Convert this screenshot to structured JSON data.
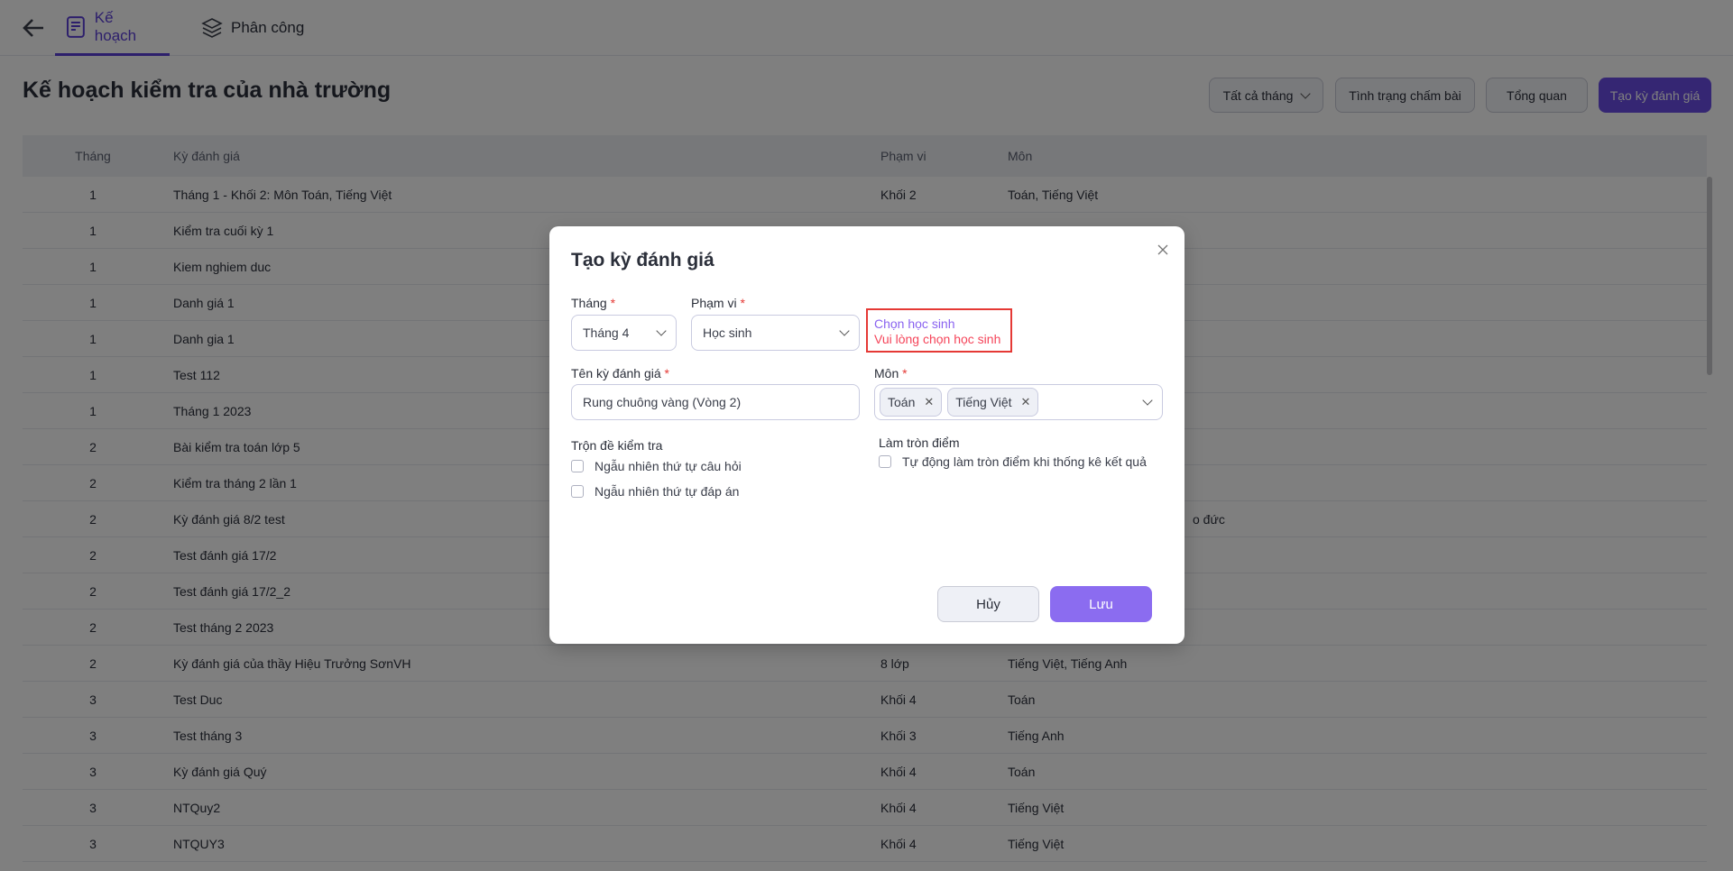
{
  "nav": {
    "back_icon": "arrow-left-icon",
    "tabs": [
      {
        "label": "Kế hoạch",
        "icon": "plan-document-icon",
        "active": true
      },
      {
        "label": "Phân công",
        "icon": "layers-icon",
        "active": false
      }
    ]
  },
  "page": {
    "title": "Kế hoạch kiểm tra của nhà trường",
    "month_filter": "Tất cả tháng",
    "grading_status": "Tình trạng chấm bài",
    "overview": "Tổng quan",
    "create": "Tạo kỳ đánh giá"
  },
  "colors": {
    "accent": "#6a4ce6",
    "save": "#8b6cf0",
    "error": "#f5455a",
    "link": "#8a63f0"
  },
  "table": {
    "headers": [
      "Tháng",
      "Kỳ đánh giá",
      "Phạm vi",
      "Môn"
    ],
    "rows": [
      {
        "month": "1",
        "name": "Tháng 1 - Khối 2: Môn Toán, Tiếng Việt",
        "scope": "Khối 2",
        "subject": "Toán, Tiếng Việt"
      },
      {
        "month": "1",
        "name": "Kiểm tra cuối kỳ 1",
        "scope": "",
        "subject": ""
      },
      {
        "month": "1",
        "name": "Kiem nghiem duc",
        "scope": "",
        "subject": ""
      },
      {
        "month": "1",
        "name": "Danh giá 1",
        "scope": "",
        "subject": ""
      },
      {
        "month": "1",
        "name": "Danh gia 1",
        "scope": "",
        "subject": ""
      },
      {
        "month": "1",
        "name": "Test 112",
        "scope": "",
        "subject": ""
      },
      {
        "month": "1",
        "name": "Tháng 1 2023",
        "scope": "",
        "subject": ""
      },
      {
        "month": "2",
        "name": "Bài kiểm tra toán lớp 5",
        "scope": "",
        "subject": ""
      },
      {
        "month": "2",
        "name": "Kiểm tra tháng 2 lần 1",
        "scope": "",
        "subject": ""
      },
      {
        "month": "2",
        "name": "Kỳ đánh giá 8/2 test",
        "scope": "",
        "subject": "",
        "subject_tail": "o đức"
      },
      {
        "month": "2",
        "name": "Test đánh giá 17/2",
        "scope": "",
        "subject": ""
      },
      {
        "month": "2",
        "name": "Test đánh giá 17/2_2",
        "scope": "",
        "subject": ""
      },
      {
        "month": "2",
        "name": "Test tháng 2 2023",
        "scope": "",
        "subject": ""
      },
      {
        "month": "2",
        "name": "Kỳ đánh giá của thầy Hiệu Trưởng SơnVH",
        "scope": "8 lớp",
        "subject": "Tiếng Việt, Tiếng Anh"
      },
      {
        "month": "3",
        "name": "Test Duc",
        "scope": "Khối 4",
        "subject": "Toán"
      },
      {
        "month": "3",
        "name": "Test tháng 3",
        "scope": "Khối 3",
        "subject": "Tiếng Anh"
      },
      {
        "month": "3",
        "name": "Kỳ đánh giá Quý",
        "scope": "Khối 4",
        "subject": "Toán"
      },
      {
        "month": "3",
        "name": "NTQuy2",
        "scope": "Khối 4",
        "subject": "Tiếng Việt"
      },
      {
        "month": "3",
        "name": "NTQUY3",
        "scope": "Khối 4",
        "subject": "Tiếng Việt"
      }
    ]
  },
  "modal": {
    "title": "Tạo kỳ đánh giá",
    "month_label": "Tháng",
    "month_value": "Tháng 4",
    "scope_label": "Phạm vi",
    "scope_value": "Học sinh",
    "choose_students": "Chọn học sinh",
    "choose_error": "Vui lòng chọn học sinh",
    "name_label": "Tên kỳ đánh giá",
    "name_value": "Rung chuông vàng (Vòng 2)",
    "subject_label": "Môn",
    "subjects": [
      "Toán",
      "Tiếng Việt"
    ],
    "shuffle_label": "Trộn đề kiểm tra",
    "shuffle_questions": "Ngẫu nhiên thứ tự câu hỏi",
    "shuffle_answers": "Ngẫu nhiên thứ tự đáp án",
    "round_label": "Làm tròn điểm",
    "round_auto": "Tự động làm tròn điểm khi thống kê kết quả",
    "cancel": "Hủy",
    "save": "Lưu",
    "required_mark": "*"
  }
}
